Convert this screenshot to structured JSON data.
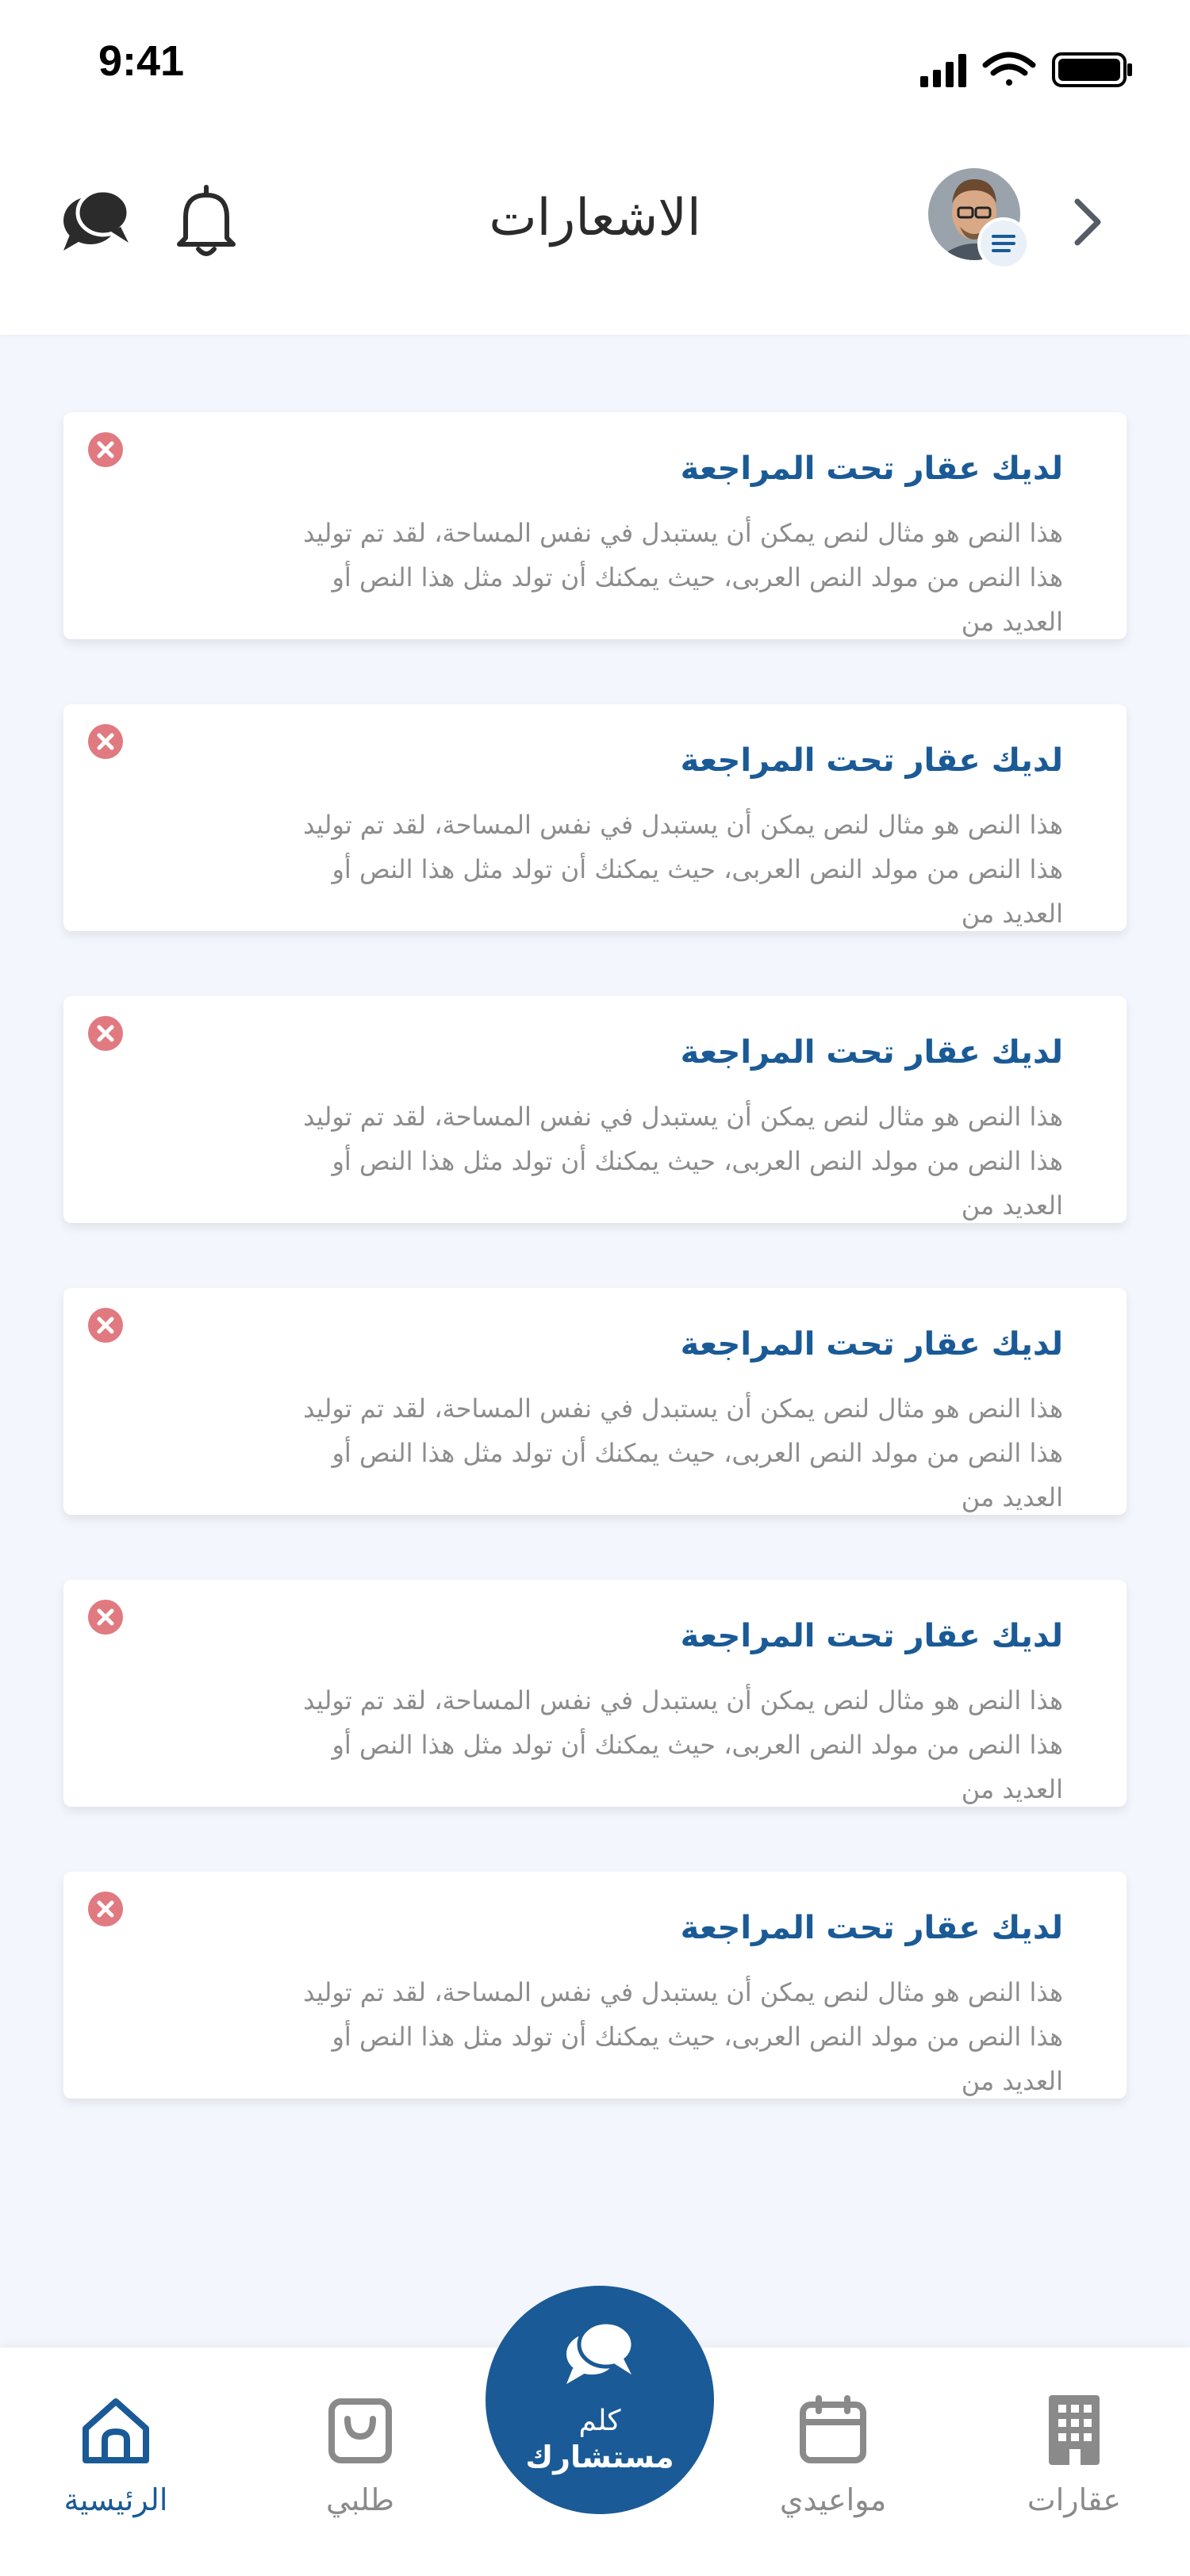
{
  "status_bar": {
    "time": "9:41"
  },
  "header": {
    "title": "الاشعارات"
  },
  "notifications": [
    {
      "title": "لديك عقار تحت المراجعة",
      "body": "هذا النص هو مثال لنص يمكن أن يستبدل في نفس المساحة، لقد تم توليد هذا النص من مولد النص العربى، حيث يمكنك أن تولد مثل هذا النص أو العديد من"
    },
    {
      "title": "لديك عقار تحت المراجعة",
      "body": "هذا النص هو مثال لنص يمكن أن يستبدل في نفس المساحة، لقد تم توليد هذا النص من مولد النص العربى، حيث يمكنك أن تولد مثل هذا النص أو العديد من"
    },
    {
      "title": "لديك عقار تحت المراجعة",
      "body": "هذا النص هو مثال لنص يمكن أن يستبدل في نفس المساحة، لقد تم توليد هذا النص من مولد النص العربى، حيث يمكنك أن تولد مثل هذا النص أو العديد من"
    },
    {
      "title": "لديك عقار تحت المراجعة",
      "body": "هذا النص هو مثال لنص يمكن أن يستبدل في نفس المساحة، لقد تم توليد هذا النص من مولد النص العربى، حيث يمكنك أن تولد مثل هذا النص أو العديد من"
    },
    {
      "title": "لديك عقار تحت المراجعة",
      "body": "هذا النص هو مثال لنص يمكن أن يستبدل في نفس المساحة، لقد تم توليد هذا النص من مولد النص العربى، حيث يمكنك أن تولد مثل هذا النص أو العديد من"
    },
    {
      "title": "لديك عقار تحت المراجعة",
      "body": "هذا النص هو مثال لنص يمكن أن يستبدل في نفس المساحة، لقد تم توليد هذا النص من مولد النص العربى، حيث يمكنك أن تولد مثل هذا النص أو العديد من"
    }
  ],
  "bottom_nav": {
    "items": [
      {
        "label": "الرئيسية",
        "icon": "home-icon",
        "active": true
      },
      {
        "label": "طلبي",
        "icon": "shopping-bag-icon",
        "active": false
      },
      {
        "label": "مواعيدي",
        "icon": "calendar-icon",
        "active": false
      },
      {
        "label": "عقارات",
        "icon": "building-icon",
        "active": false
      }
    ],
    "consult": {
      "line1": "كلم",
      "line2": "مستشارك",
      "icon": "chat-bubbles-icon"
    }
  },
  "colors": {
    "accent": "#1a5a96",
    "close": "#e07a80",
    "background": "#f3f6fc",
    "muted_text": "#8c8c8c"
  }
}
